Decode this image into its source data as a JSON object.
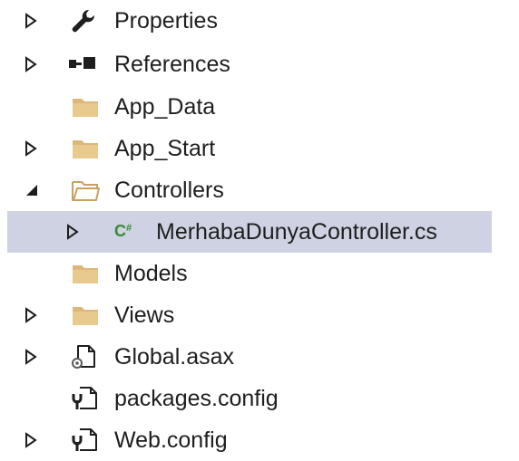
{
  "solution_explorer": {
    "items": [
      {
        "label": "Properties",
        "icon": "wrench-icon",
        "expander": "collapsed"
      },
      {
        "label": "References",
        "icon": "references-icon",
        "expander": "collapsed"
      },
      {
        "label": "App_Data",
        "icon": "folder-icon",
        "expander": "none"
      },
      {
        "label": "App_Start",
        "icon": "folder-icon",
        "expander": "collapsed"
      },
      {
        "label": "Controllers",
        "icon": "folder-open-icon",
        "expander": "expanded"
      },
      {
        "label": "MerhabaDunyaController.cs",
        "icon": "csharp-file-icon",
        "expander": "collapsed",
        "selected": true
      },
      {
        "label": "Models",
        "icon": "folder-icon",
        "expander": "none"
      },
      {
        "label": "Views",
        "icon": "folder-icon",
        "expander": "collapsed"
      },
      {
        "label": "Global.asax",
        "icon": "asax-file-icon",
        "expander": "collapsed"
      },
      {
        "label": "packages.config",
        "icon": "config-file-icon",
        "expander": "none"
      },
      {
        "label": "Web.config",
        "icon": "config-file-icon",
        "expander": "collapsed"
      }
    ]
  },
  "colors": {
    "selected_row": "#cfd2e3",
    "folder": "#dcb67a",
    "csharp_icon": "#388a34",
    "text": "#1e1e1e"
  }
}
